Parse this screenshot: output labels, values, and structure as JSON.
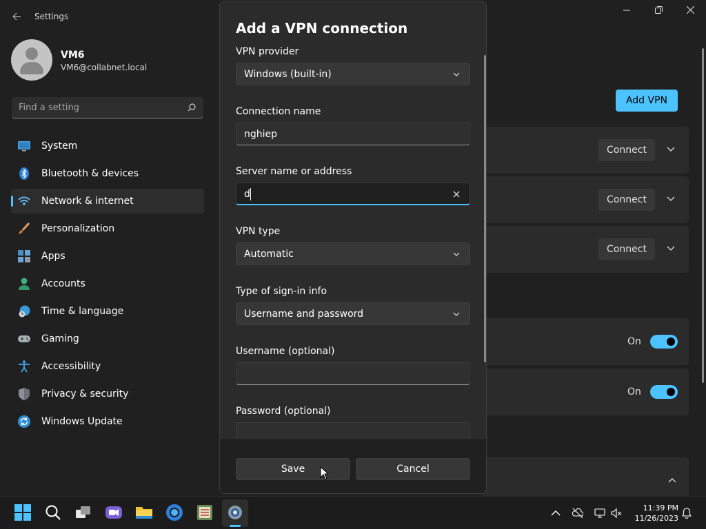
{
  "window": {
    "app_title": "Settings",
    "back_icon": "back-arrow-icon",
    "controls": [
      "minimize-icon",
      "maximize-icon",
      "close-icon"
    ]
  },
  "user": {
    "name": "VM6",
    "email": "VM6@collabnet.local"
  },
  "search": {
    "placeholder": "Find a setting",
    "value": ""
  },
  "sidebar": {
    "selected": "Network & internet",
    "items": [
      {
        "label": "System",
        "icon": "system-icon"
      },
      {
        "label": "Bluetooth & devices",
        "icon": "bluetooth-icon"
      },
      {
        "label": "Network & internet",
        "icon": "wifi-icon"
      },
      {
        "label": "Personalization",
        "icon": "brush-icon"
      },
      {
        "label": "Apps",
        "icon": "apps-icon"
      },
      {
        "label": "Accounts",
        "icon": "accounts-icon"
      },
      {
        "label": "Time & language",
        "icon": "globe-clock-icon"
      },
      {
        "label": "Gaming",
        "icon": "gamepad-icon"
      },
      {
        "label": "Accessibility",
        "icon": "accessibility-icon"
      },
      {
        "label": "Privacy & security",
        "icon": "shield-icon"
      },
      {
        "label": "Windows Update",
        "icon": "update-icon"
      }
    ]
  },
  "main": {
    "add_vpn_label": "Add VPN",
    "vpn_connections": [
      {
        "connect_label": "Connect"
      },
      {
        "connect_label": "Connect"
      },
      {
        "connect_label": "Connect"
      }
    ],
    "toggles": [
      {
        "state_label": "On",
        "on": true
      },
      {
        "state_label": "On",
        "on": true
      }
    ]
  },
  "dialog": {
    "title": "Add a VPN connection",
    "vpn_provider": {
      "label": "VPN provider",
      "value": "Windows (built-in)"
    },
    "connection_name": {
      "label": "Connection name",
      "value": "nghiep"
    },
    "server": {
      "label": "Server name or address",
      "value": "d"
    },
    "vpn_type": {
      "label": "VPN type",
      "value": "Automatic"
    },
    "sign_in_type": {
      "label": "Type of sign-in info",
      "value": "Username and password"
    },
    "username": {
      "label": "Username (optional)",
      "value": ""
    },
    "password": {
      "label": "Password (optional)"
    },
    "save_label": "Save",
    "cancel_label": "Cancel"
  },
  "taskbar": {
    "pinned": [
      "start-icon",
      "search-icon",
      "task-view-icon",
      "teams-icon",
      "file-explorer-icon",
      "chrome-icon",
      "app-icon",
      "settings-icon"
    ],
    "active": "settings-icon",
    "time": "11:39 PM",
    "date": "11/26/2023"
  },
  "colors": {
    "accent": "#4cc2ff",
    "background": "#202020",
    "card": "#2b2b2b"
  }
}
